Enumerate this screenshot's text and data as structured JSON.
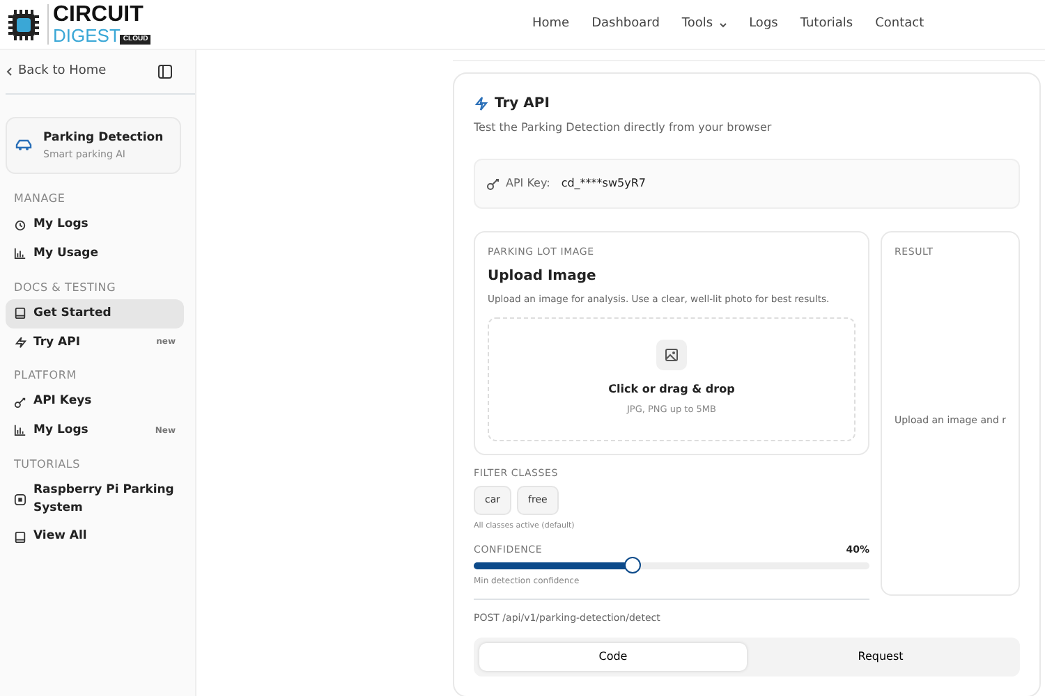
{
  "header": {
    "logo": {
      "word_1": "CIRCUIT",
      "word_2": "DIGEST",
      "tag": "CLOUD"
    },
    "nav": [
      {
        "label": "Home",
        "kind": "link"
      },
      {
        "label": "Dashboard",
        "kind": "link"
      },
      {
        "label": "Tools",
        "kind": "dropdown"
      },
      {
        "label": "Logs",
        "kind": "link"
      },
      {
        "label": "Tutorials",
        "kind": "link"
      },
      {
        "label": "Contact",
        "kind": "link"
      }
    ]
  },
  "sidebar": {
    "back_link": "Back to Home",
    "product": {
      "name": "Parking Detection",
      "subtitle": "Smart parking AI"
    },
    "sections": [
      {
        "title": "MANAGE",
        "items": [
          {
            "label": "My Logs",
            "selected": false
          },
          {
            "label": "My Usage",
            "selected": false
          }
        ]
      },
      {
        "title": "DOCS & TESTING",
        "items": [
          {
            "label": "Get Started",
            "selected": true
          },
          {
            "label": "Try API",
            "badge": "new",
            "selected": false
          }
        ]
      },
      {
        "title": "PLATFORM",
        "items": [
          {
            "label": "API Keys",
            "selected": false
          },
          {
            "label": "My Logs",
            "badge": "New",
            "selected": false
          }
        ]
      },
      {
        "title": "TUTORIALS",
        "items": [
          {
            "label": "Raspberry Pi Parking System",
            "selected": false
          },
          {
            "label": "View All",
            "selected": false
          }
        ]
      }
    ]
  },
  "try_api": {
    "title": "Try API",
    "subtitle": "Test the Parking Detection directly from your browser",
    "api_key": {
      "label": "API Key:",
      "value": "cd_****sw5yR7"
    },
    "upload": {
      "eyebrow": "PARKING LOT IMAGE",
      "title": "Upload Image",
      "description": "Upload an image for analysis. Use a clear, well-lit photo for best results.",
      "drop_title": "Click or drag & drop",
      "drop_hint": "JPG, PNG up to 5MB"
    },
    "filter": {
      "title": "FILTER CLASSES",
      "chips": [
        "car",
        "free"
      ],
      "hint": "All classes active (default)"
    },
    "confidence": {
      "title": "CONFIDENCE",
      "reading": "40%",
      "level": 0.4,
      "hint": "Min detection confidence"
    },
    "result": {
      "title": "RESULT",
      "message": "Upload an image and r"
    },
    "endpoint": "POST /api/v1/parking-detection/detect",
    "code_tabs": [
      {
        "label": "Code",
        "selected": true
      },
      {
        "label": "Request",
        "selected": false
      }
    ]
  }
}
